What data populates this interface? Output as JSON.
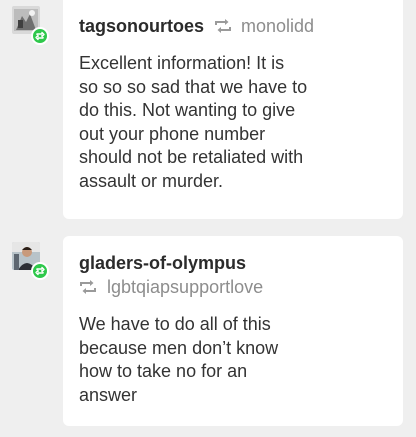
{
  "posts": [
    {
      "username": "tagsonourtoes",
      "reblogged_from": "monolidd",
      "text": "Excellent information! It is\nso so so sad that we have to\ndo this. Not wanting to give\nout your phone number\nshould not be retaliated with\nassault or murder."
    },
    {
      "username": "gladers-of-olympus",
      "reblogged_from": "lgbtqiapsupportlove",
      "text": "We have to do all of this\nbecause men don’t know\nhow to take no for an\nanswer"
    }
  ],
  "icons": {
    "reblog": "reblog-icon",
    "badge": "reblog-badge-icon"
  },
  "colors": {
    "badge_green": "#2ec84b",
    "background": "#efefef",
    "card": "#ffffff",
    "username": "#2b2b2b",
    "secondary": "#8d8d8d"
  }
}
